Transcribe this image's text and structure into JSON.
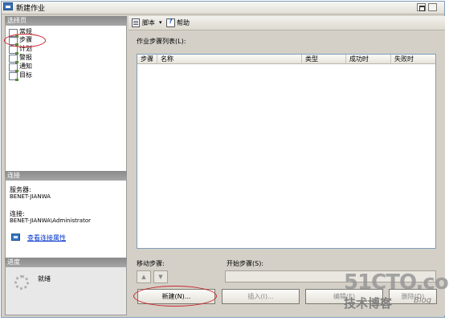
{
  "window": {
    "title": "新建作业"
  },
  "left": {
    "select_page_header": "选择页",
    "pages": [
      {
        "label": "常规",
        "icon": "page-icon"
      },
      {
        "label": "步骤",
        "icon": "page-icon"
      },
      {
        "label": "计划",
        "icon": "page-icon"
      },
      {
        "label": "警报",
        "icon": "page-icon"
      },
      {
        "label": "通知",
        "icon": "page-icon"
      },
      {
        "label": "目标",
        "icon": "page-icon"
      }
    ],
    "connection_header": "连接",
    "server_label": "服务器:",
    "server_value": "BENET-JIANWA",
    "connection_label": "连接:",
    "connection_value": "BENET-JIANWA\\Administrator",
    "view_connection_link": "查看连接属性",
    "progress_header": "进度",
    "status": "就绪"
  },
  "toolbar": {
    "script_label": "脚本",
    "dropdown": "▾",
    "help_label": "帮助"
  },
  "main": {
    "list_label": "作业步骤列表(L):",
    "columns": [
      "步骤",
      "名称",
      "类型",
      "成功时",
      "失败时"
    ],
    "move_label": "移动步骤:",
    "start_step_label": "开始步骤(S):",
    "move_up": "▲",
    "move_down": "▼",
    "buttons": {
      "new": "新建(N)...",
      "insert": "插入(I)...",
      "edit": "编辑(E)",
      "delete": "删除(D)"
    }
  },
  "watermark": {
    "main": "51CTO.com",
    "sub": "技术博客",
    "blog": "Blog"
  },
  "colors": {
    "annotation_ring": "#c7252a",
    "link": "#0033cc",
    "header_gray": "#8a8a8a"
  }
}
